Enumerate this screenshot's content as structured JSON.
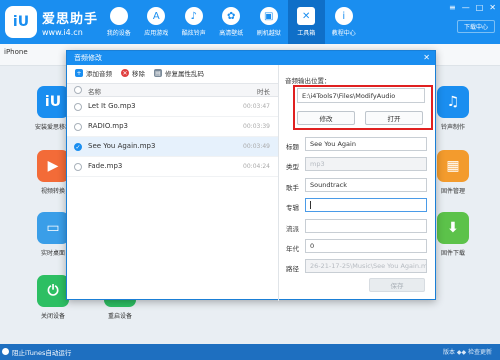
{
  "app": {
    "title": "爱思助手",
    "url": "www.i4.cn",
    "logo_glyph": "iU"
  },
  "nav": [
    {
      "label": "我的设备",
      "icon": "apple-icon",
      "glyph": ""
    },
    {
      "label": "应用游戏",
      "icon": "appstore-icon",
      "glyph": "A"
    },
    {
      "label": "酷炫铃声",
      "icon": "bell-icon",
      "glyph": "♪"
    },
    {
      "label": "高清壁纸",
      "icon": "flower-icon",
      "glyph": "✿"
    },
    {
      "label": "刷机越狱",
      "icon": "box-icon",
      "glyph": "▣"
    },
    {
      "label": "工具箱",
      "icon": "tools-icon",
      "glyph": "✕"
    },
    {
      "label": "教程中心",
      "icon": "info-icon",
      "glyph": "i"
    }
  ],
  "window_controls": [
    "≡",
    "—",
    "□",
    "✕"
  ],
  "download_label": "下载中心",
  "device_tab": "iPhone",
  "bg_apps": [
    {
      "label": "安装爱思移动",
      "icon": "i4-app-icon",
      "glyph": "iU",
      "color": "#1a8ef0"
    },
    {
      "label": "视频转换",
      "icon": "video-icon",
      "glyph": "▶",
      "color": "#f36b38"
    },
    {
      "label": "实时桌面",
      "icon": "desktop-icon",
      "glyph": "▭",
      "color": "#3a9ee8"
    },
    {
      "label": "关闭设备",
      "icon": "power-icon",
      "glyph": "⏻",
      "color": "#2dbf63"
    },
    {
      "label": "重启设备",
      "icon": "restart-icon",
      "glyph": "↻",
      "color": "#2dbf63"
    },
    {
      "label": "铃声制作",
      "icon": "ringtone-icon",
      "glyph": "♫",
      "color": "#1a8ef0"
    },
    {
      "label": "固件管理",
      "icon": "firmware-icon",
      "glyph": "▦",
      "color": "#f39b2d"
    },
    {
      "label": "固件下载",
      "icon": "download-icon",
      "glyph": "⬇",
      "color": "#5cc24a"
    }
  ],
  "status": {
    "label": "阻止iTunes自动运行",
    "right": "版本 ◆◆ 检查更新"
  },
  "dialog": {
    "title": "音频修改",
    "close": "✕",
    "toolbar": [
      {
        "label": "添加音频",
        "icon": "add-icon",
        "glyph": "+",
        "color": "#1a8ef0"
      },
      {
        "label": "移除",
        "icon": "remove-icon",
        "glyph": "✕",
        "color": "#e04040"
      },
      {
        "label": "修复属性乱码",
        "icon": "repair-icon",
        "glyph": "▤",
        "color": "#7a8a99"
      }
    ],
    "columns": {
      "name": "名称",
      "duration": "时长"
    },
    "rows": [
      {
        "name": "Let It Go.mp3",
        "duration": "00:03:47",
        "selected": false
      },
      {
        "name": "RADIO.mp3",
        "duration": "00:03:39",
        "selected": false
      },
      {
        "name": "See You Again.mp3",
        "duration": "00:03:49",
        "selected": true
      },
      {
        "name": "Fade.mp3",
        "duration": "00:04:24",
        "selected": false
      }
    ],
    "output": {
      "label": "音频输出位置：",
      "path": "E:\\i4Tools7\\Files\\ModifyAudio",
      "modify_label": "修改",
      "open_label": "打开"
    },
    "fields": {
      "title": {
        "label": "标题",
        "value": "See You Again"
      },
      "type": {
        "label": "类型",
        "value": "mp3"
      },
      "artist": {
        "label": "歌手",
        "value": "Soundtrack"
      },
      "album": {
        "label": "专辑",
        "value": ""
      },
      "genre": {
        "label": "流派",
        "value": ""
      },
      "year": {
        "label": "年代",
        "value": "0"
      },
      "path": {
        "label": "路径",
        "value": "26-21-17-25\\Music\\See You Again.mp3"
      }
    },
    "save_label": "保存"
  },
  "colors": {
    "primary": "#1a8ef0",
    "highlight": "#e02020"
  }
}
